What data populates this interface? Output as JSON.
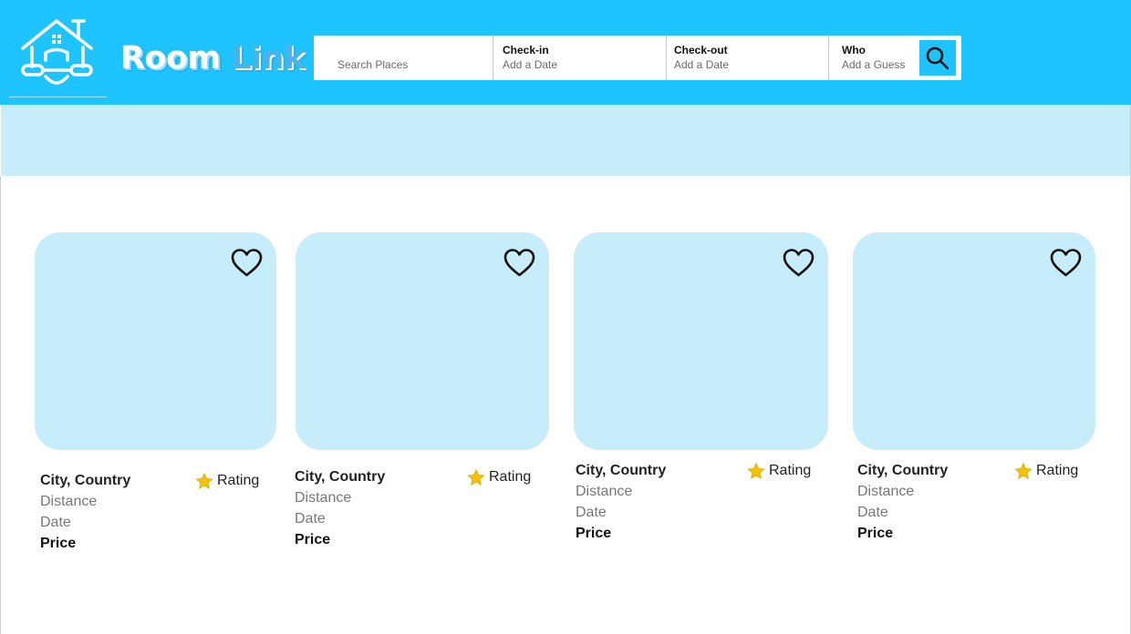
{
  "brand": {
    "word1": "Room",
    "word2": "Link"
  },
  "search": {
    "where_placeholder": "Search Places",
    "checkin_title": "Check-in",
    "checkin_value": "Add a Date",
    "checkout_title": "Check-out",
    "checkout_value": "Add a Date",
    "who_title": "Who",
    "who_value": "Add a Guess",
    "button_icon": "magnifier-icon"
  },
  "colors": {
    "accent": "#1ec4ff",
    "light": "#c7ecfa",
    "star": "#f5c20b"
  },
  "listings": [
    {
      "location": "City, Country",
      "rating": "Rating",
      "distance": "Distance",
      "date": "Date",
      "price": "Price",
      "favorite_icon": "heart-outline-icon"
    },
    {
      "location": "City, Country",
      "rating": "Rating",
      "distance": "Distance",
      "date": "Date",
      "price": "Price",
      "favorite_icon": "heart-outline-icon"
    },
    {
      "location": "City, Country",
      "rating": "Rating",
      "distance": "Distance",
      "date": "Date",
      "price": "Price",
      "favorite_icon": "heart-outline-icon"
    },
    {
      "location": "City, Country",
      "rating": "Rating",
      "distance": "Distance",
      "date": "Date",
      "price": "Price",
      "favorite_icon": "heart-outline-icon"
    }
  ]
}
